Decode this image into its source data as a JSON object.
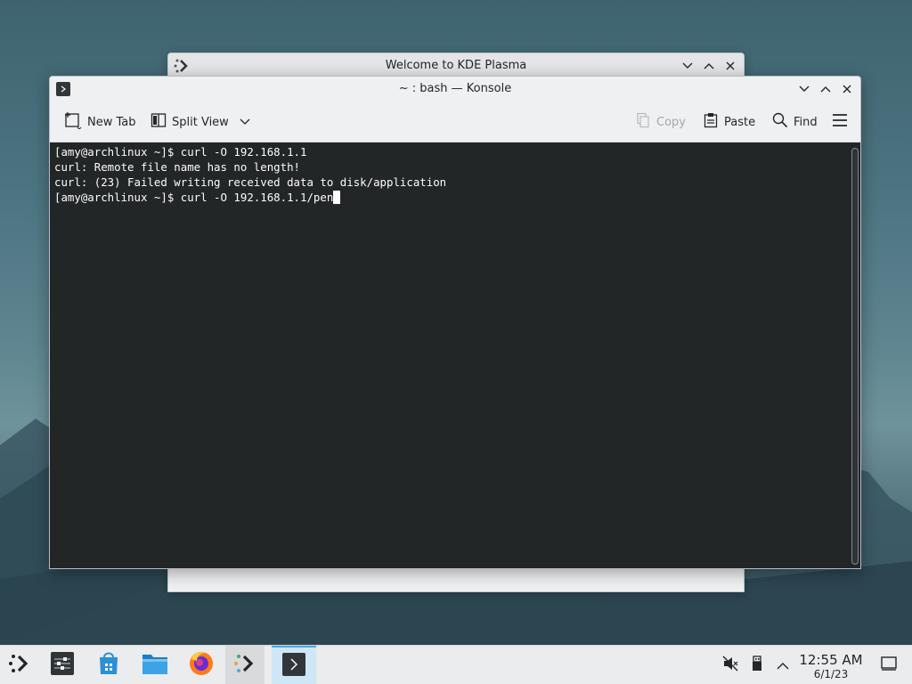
{
  "background_window": {
    "title": "Welcome to KDE Plasma"
  },
  "konsole": {
    "title": "~ : bash — Konsole",
    "toolbar": {
      "new_tab": "New Tab",
      "split_view": "Split View",
      "copy": "Copy",
      "paste": "Paste",
      "find": "Find"
    },
    "terminal_lines": [
      "[amy@archlinux ~]$ curl -O 192.168.1.1",
      "curl: Remote file name has no length!",
      "curl: (23) Failed writing received data to disk/application",
      "[amy@archlinux ~]$ curl -O 192.168.1.1/pen"
    ]
  },
  "taskbar": {
    "items": [
      "application-launcher-icon",
      "system-settings-icon",
      "discover-store-icon",
      "dolphin-files-icon",
      "firefox-icon",
      "welcome-app-icon",
      "konsole-icon"
    ],
    "tray": [
      "volume-muted-icon",
      "usb-device-icon",
      "tray-expand-icon"
    ],
    "clock": {
      "time": "12:55 AM",
      "date": "6/1/23"
    },
    "show_desktop": "show-desktop-icon"
  },
  "colors": {
    "terminal_bg": "#232627",
    "terminal_fg": "#fcfcfc",
    "accent": "#3daee9"
  }
}
